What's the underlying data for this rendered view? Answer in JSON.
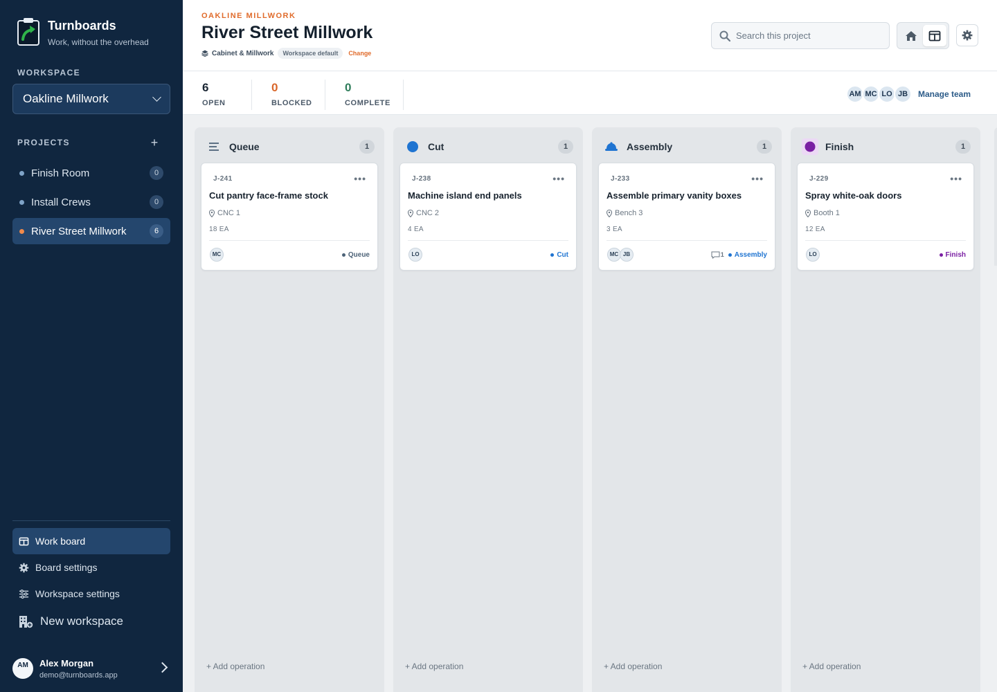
{
  "brand": {
    "name": "Turnboards",
    "tagline": "Work, without the overhead"
  },
  "sidebar": {
    "workspace_label": "WORKSPACE",
    "workspace_value": "Oakline Millwork",
    "projects_label": "PROJECTS",
    "projects": [
      {
        "label": "Finish Room",
        "count": "0"
      },
      {
        "label": "Install Crews",
        "count": "0"
      },
      {
        "label": "River Street Millwork",
        "count": "6"
      }
    ],
    "nav": [
      {
        "label": "Work board",
        "icon": "board-icon"
      },
      {
        "label": "Board settings",
        "icon": "gear-icon"
      },
      {
        "label": "Workspace settings",
        "icon": "sliders-icon"
      },
      {
        "label": "New workspace",
        "icon": "building-add-icon"
      }
    ],
    "user": {
      "initials": "AM",
      "name": "Alex Morgan",
      "email": "demo@turnboards.app"
    }
  },
  "header": {
    "eyebrow": "OAKLINE MILLWORK",
    "title": "River Street Millwork",
    "category": "Cabinet & Millwork",
    "badge": "Workspace default",
    "change": "Change",
    "search_placeholder": "Search this project"
  },
  "stats": [
    {
      "value": "6",
      "label": "OPEN",
      "color": "#14202d"
    },
    {
      "value": "0",
      "label": "BLOCKED",
      "color": "#d9662a"
    },
    {
      "value": "0",
      "label": "COMPLETE",
      "color": "#2f7d5b"
    }
  ],
  "team": {
    "members": [
      "AM",
      "MC",
      "LO",
      "JB"
    ],
    "manage": "Manage team"
  },
  "colors": {
    "accent": "#e06b2b",
    "sidebar": "#10263f",
    "queue": "#4d6378",
    "cut": "#1f74d1",
    "assembly": "#1f74d1",
    "finish": "#7a1fa3"
  },
  "columns": [
    {
      "title": "Queue",
      "count": "1",
      "icon": "lines-icon",
      "add": "+ Add operation",
      "card": {
        "id": "J-241",
        "title": "Cut pantry face-frame stock",
        "location": "CNC 1",
        "qty": "18 EA",
        "assignees": [
          "MC"
        ],
        "comments": "",
        "tag": "Queue",
        "tag_color": "#4d6378"
      }
    },
    {
      "title": "Cut",
      "count": "1",
      "icon": "circle-icon",
      "add": "+ Add operation",
      "card": {
        "id": "J-238",
        "title": "Machine island end panels",
        "location": "CNC 2",
        "qty": "4 EA",
        "assignees": [
          "LO"
        ],
        "comments": "",
        "tag": "Cut",
        "tag_color": "#1f74d1"
      }
    },
    {
      "title": "Assembly",
      "count": "1",
      "icon": "hardhat-icon",
      "add": "+ Add operation",
      "card": {
        "id": "J-233",
        "title": "Assemble primary vanity boxes",
        "location": "Bench 3",
        "qty": "3 EA",
        "assignees": [
          "MC",
          "JB"
        ],
        "comments": "1",
        "tag": "Assembly",
        "tag_color": "#1f74d1"
      }
    },
    {
      "title": "Finish",
      "count": "1",
      "icon": "circle-icon",
      "add": "+ Add operation",
      "card": {
        "id": "J-229",
        "title": "Spray white-oak doors",
        "location": "Booth 1",
        "qty": "12 EA",
        "assignees": [
          "LO"
        ],
        "comments": "",
        "tag": "Finish",
        "tag_color": "#7a1fa3"
      }
    }
  ]
}
